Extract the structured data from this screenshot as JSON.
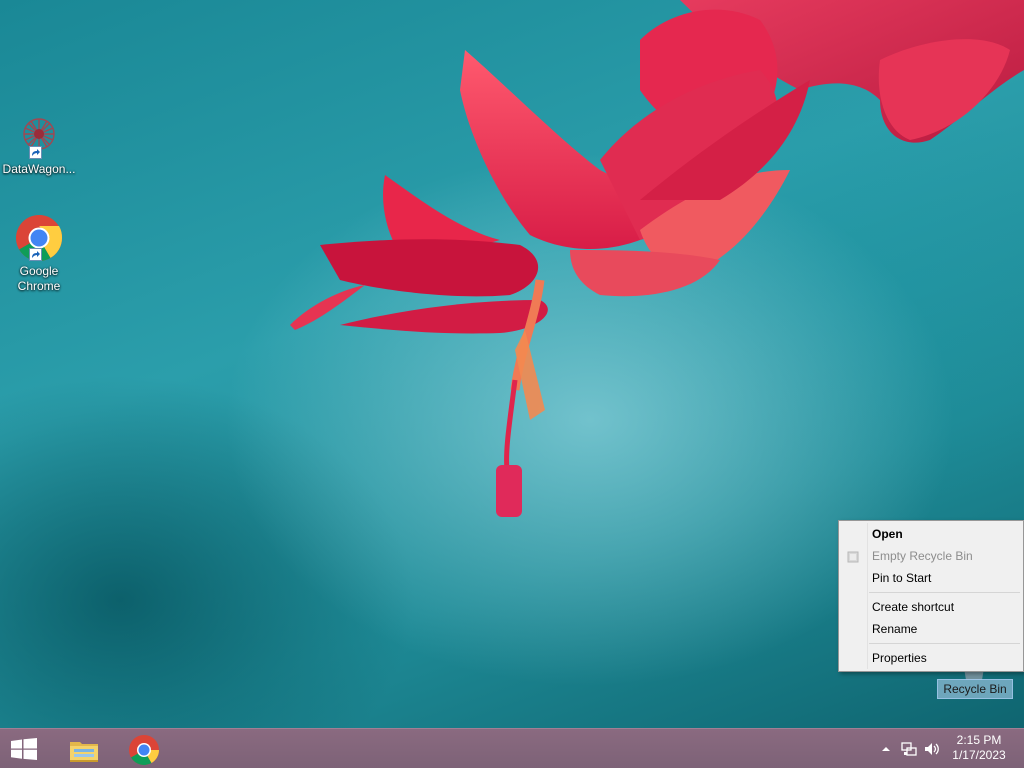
{
  "desktop": {
    "icons": [
      {
        "label": "DataWagon...",
        "icon": "datawagon-app-icon"
      },
      {
        "label": "Google Chrome",
        "icon": "chrome-icon"
      }
    ],
    "recycle_bin_label": "Recycle Bin"
  },
  "context_menu": {
    "items": [
      {
        "label": "Open",
        "bold": true,
        "enabled": true
      },
      {
        "label": "Empty Recycle Bin",
        "enabled": false
      },
      {
        "label": "Pin to Start",
        "enabled": true
      },
      {
        "label": "Create shortcut",
        "enabled": true
      },
      {
        "label": "Rename",
        "enabled": true
      },
      {
        "label": "Properties",
        "enabled": true
      }
    ]
  },
  "taskbar": {
    "pinned": [
      "file-explorer-icon",
      "chrome-icon"
    ],
    "clock": {
      "time": "2:15 PM",
      "date": "1/17/2023"
    },
    "tray_icons": [
      "chevron-up-icon",
      "network-icon",
      "volume-icon"
    ]
  },
  "colors": {
    "wallpaper_teal": "#2b9eab",
    "flower_red": "#e8264a",
    "taskbar": "#7d6277",
    "menu_bg": "#f0f0f0"
  }
}
